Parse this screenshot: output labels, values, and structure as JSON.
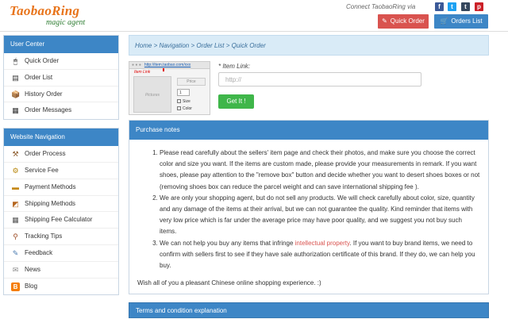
{
  "logo": {
    "main": "TaobaoRing",
    "sub": "magic agent"
  },
  "header": {
    "connect_text": "Connect TaobaoRing via",
    "social": [
      {
        "name": "facebook",
        "glyph": "f",
        "color": "#3b5998"
      },
      {
        "name": "twitter",
        "glyph": "t",
        "color": "#1da1f2"
      },
      {
        "name": "tumblr",
        "glyph": "t",
        "color": "#35465c"
      },
      {
        "name": "pinterest",
        "glyph": "p",
        "color": "#cb2027"
      }
    ],
    "quick_order": "Quick Order",
    "orders_list": "Orders List"
  },
  "sidebar": {
    "user_center": {
      "title": "User Center",
      "items": [
        {
          "label": "Quick Order",
          "icon": "mouse-icon"
        },
        {
          "label": "Order List",
          "icon": "list-icon"
        },
        {
          "label": "History Order",
          "icon": "history-icon"
        },
        {
          "label": "Order Messages",
          "icon": "messages-icon"
        }
      ]
    },
    "website_navigation": {
      "title": "Website Navigation",
      "items": [
        {
          "label": "Order Process",
          "icon": "process-icon"
        },
        {
          "label": "Service Fee",
          "icon": "fee-icon"
        },
        {
          "label": "Payment Methods",
          "icon": "payment-icon"
        },
        {
          "label": "Shipping Methods",
          "icon": "shipping-icon"
        },
        {
          "label": "Shipping Fee Calculator",
          "icon": "calculator-icon"
        },
        {
          "label": "Tracking Tips",
          "icon": "tracking-icon"
        },
        {
          "label": "Feedback",
          "icon": "feedback-icon"
        },
        {
          "label": "News",
          "icon": "news-icon"
        },
        {
          "label": "Blog",
          "icon": "blog-icon"
        }
      ]
    }
  },
  "main": {
    "breadcrumb": "Home > Navigation > Order List > Quick Order",
    "illustration": {
      "url": "http://item.taobao.com/xxx",
      "item_link": "Item Link",
      "pictures": "Pictures",
      "price": "Price",
      "qty": "1",
      "size": "Size",
      "color": "Color"
    },
    "item_link_label": "* Item Link:",
    "item_link_placeholder": "http://",
    "get_it_button": "Get It !",
    "purchase_notes": {
      "title": "Purchase notes",
      "items": [
        {
          "text": "Please read carefully about the sellers' item page and check their photos, and make sure you choose the correct color and size you want. If the items are custom made, please provide your measurements in remark. If you want shoes, please pay attention to the \"remove box\" button and decide whether you want to desert shoes boxes or not (removing shoes box can reduce the parcel weight and can save international shipping fee )."
        },
        {
          "text": "We are only your shopping agent, but do not sell any products. We will check carefully about color, size, quantity and any damage of the items at their arrival, but we can not guarantee the quality. Kind reminder that items with very low price which is far under the average price may have poor quality, and we suggest you not buy such items."
        },
        {
          "pre": "We can not help you buy any items that infringe ",
          "highlight": "intellectual property",
          "post": ". If you want to buy brand items, we need to confirm with sellers first to see if they have sale authorization certificate of this brand. If they do, we can help you buy."
        }
      ],
      "wish": "Wish all of you a pleasant Chinese online shopping experience. :)"
    },
    "terms_title": "Terms and condition explanation"
  },
  "colors": {
    "brand_orange": "#e8741b",
    "panel_blue": "#3d86c6",
    "quick_order_red": "#d9534f",
    "orders_list_blue": "#3d86c6",
    "get_it_green": "#3fb64a"
  }
}
